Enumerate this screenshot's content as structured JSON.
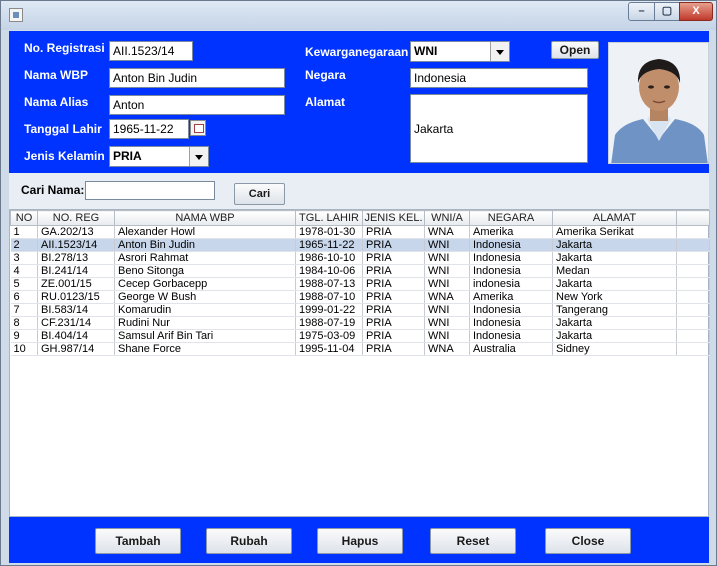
{
  "window": {
    "title": ""
  },
  "form": {
    "labels": {
      "no_registrasi": "No. Registrasi",
      "nama_wbp": "Nama WBP",
      "nama_alias": "Nama Alias",
      "tanggal_lahir": "Tanggal Lahir",
      "jenis_kelamin": "Jenis Kelamin",
      "kewarganegaraan": "Kewarganegaraan",
      "negara": "Negara",
      "alamat": "Alamat"
    },
    "values": {
      "no_registrasi": "AII.1523/14",
      "nama_wbp": "Anton Bin Judin",
      "nama_alias": "Anton",
      "tanggal_lahir": "1965-11-22",
      "jenis_kelamin": "PRIA",
      "kewarganegaraan": "WNI",
      "negara": "Indonesia",
      "alamat": "Jakarta"
    },
    "open_button": "Open"
  },
  "search": {
    "label": "Cari Nama:",
    "value": "",
    "button": "Cari"
  },
  "table": {
    "columns": [
      "NO",
      "NO. REG",
      "NAMA WBP",
      "TGL. LAHIR",
      "JENIS KEL.",
      "WNI/A",
      "NEGARA",
      "ALAMAT"
    ],
    "rows": [
      [
        "1",
        "GA.202/13",
        "Alexander Howl",
        "1978-01-30",
        "PRIA",
        "WNA",
        "Amerika",
        "Amerika Serikat"
      ],
      [
        "2",
        "AII.1523/14",
        "Anton Bin Judin",
        "1965-11-22",
        "PRIA",
        "WNI",
        "Indonesia",
        "Jakarta"
      ],
      [
        "3",
        "BI.278/13",
        "Asrori Rahmat",
        "1986-10-10",
        "PRIA",
        "WNI",
        "Indonesia",
        "Jakarta"
      ],
      [
        "4",
        "BI.241/14",
        "Beno Sitonga",
        "1984-10-06",
        "PRIA",
        "WNI",
        "Indonesia",
        "Medan"
      ],
      [
        "5",
        "ZE.001/15",
        "Cecep Gorbacepp",
        "1988-07-13",
        "PRIA",
        "WNI",
        "indonesia",
        "Jakarta"
      ],
      [
        "6",
        "RU.0123/15",
        "George W Bush",
        "1988-07-10",
        "PRIA",
        "WNA",
        "Amerika",
        "New York"
      ],
      [
        "7",
        "BI.583/14",
        "Komarudin",
        "1999-01-22",
        "PRIA",
        "WNI",
        "Indonesia",
        "Tangerang"
      ],
      [
        "8",
        "CF.231/14",
        "Rudini Nur",
        "1988-07-19",
        "PRIA",
        "WNI",
        "Indonesia",
        "Jakarta"
      ],
      [
        "9",
        "BI.404/14",
        "Samsul Arif Bin Tari",
        "1975-03-09",
        "PRIA",
        "WNI",
        "Indonesia",
        "Jakarta"
      ],
      [
        "10",
        "GH.987/14",
        "Shane Force",
        "1995-11-04",
        "PRIA",
        "WNA",
        "Australia",
        "Sidney"
      ]
    ],
    "selected_row": 2
  },
  "actions": {
    "tambah": "Tambah",
    "rubah": "Rubah",
    "hapus": "Hapus",
    "reset": "Reset",
    "close": "Close"
  },
  "window_controls": {
    "minimize": "–",
    "maximize": "▢",
    "close": "X"
  },
  "colors": {
    "panel_blue": "#0033ff",
    "selection": "#c7d6ea"
  }
}
